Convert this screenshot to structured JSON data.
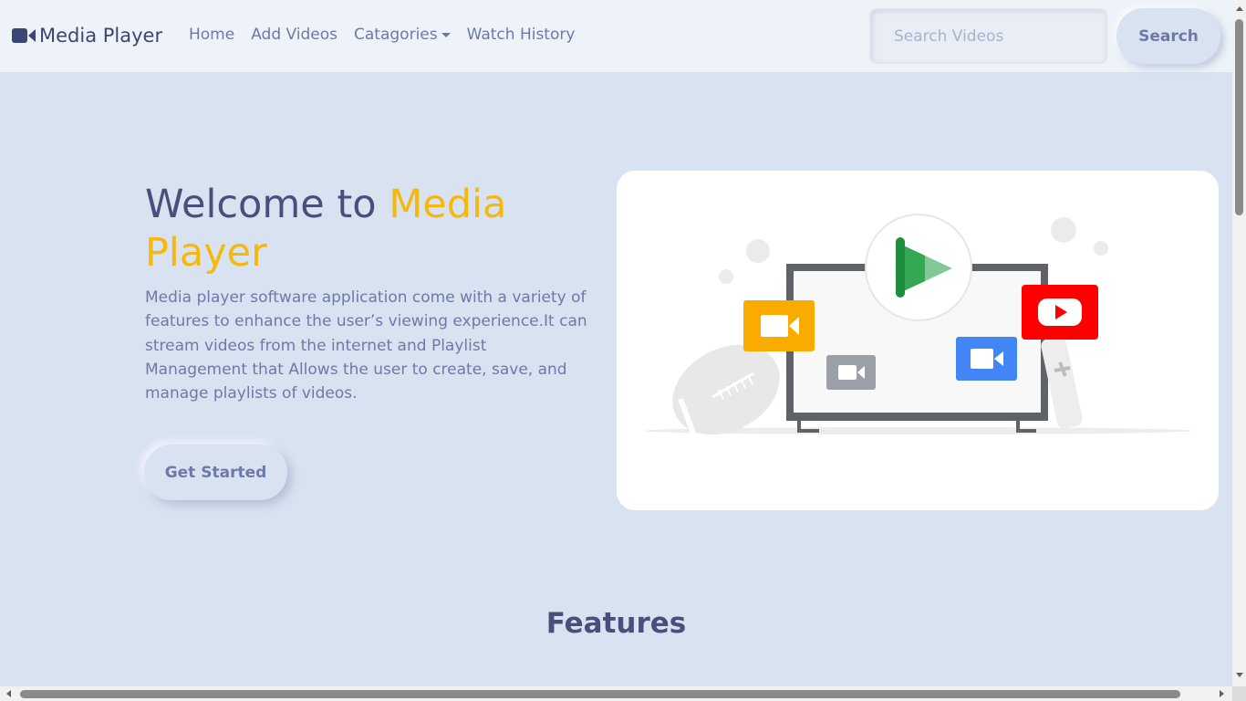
{
  "navbar": {
    "brand": "Media Player",
    "links": [
      {
        "label": "Home"
      },
      {
        "label": "Add Videos"
      },
      {
        "label": "Catagories"
      },
      {
        "label": "Watch History"
      }
    ],
    "search": {
      "placeholder": "Search Videos",
      "value": "",
      "button_label": "Search"
    }
  },
  "hero": {
    "title_part1": "Welcome to ",
    "title_accent": "Media Player",
    "description": "Media player software application come with a variety of features to enhance the user’s viewing experience.It can stream videos from the internet and Playlist Management that Allows the user to create, save, and manage playlists of videos.",
    "cta_label": "Get Started"
  },
  "features": {
    "title": "Features"
  },
  "colors": {
    "background": "#d9e2f1",
    "navbar": "#eef3f9",
    "primary_text": "#46507a",
    "muted_text": "#6c7aa8",
    "accent": "#f5b80c"
  }
}
